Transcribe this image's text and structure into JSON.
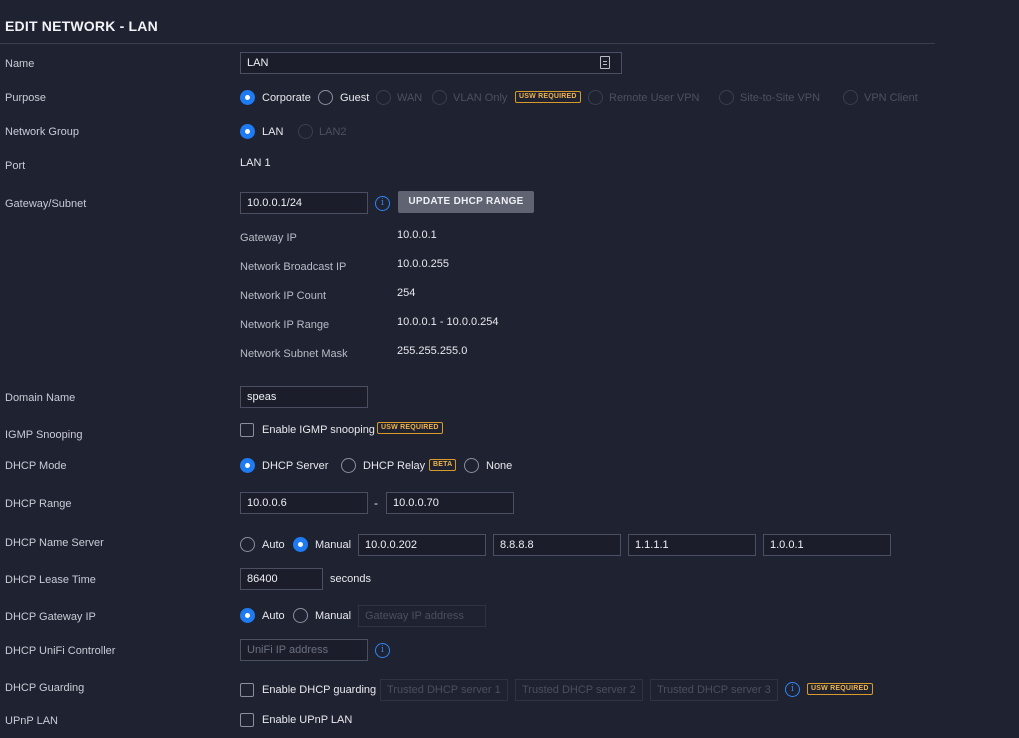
{
  "title": "EDIT NETWORK - LAN",
  "name": {
    "label": "Name",
    "value": "LAN"
  },
  "purpose": {
    "label": "Purpose",
    "options": [
      "Corporate",
      "Guest",
      "WAN",
      "VLAN Only",
      "Remote User VPN",
      "Site-to-Site VPN",
      "VPN Client"
    ],
    "selected": "Corporate",
    "badge": "USW REQUIRED"
  },
  "network_group": {
    "label": "Network Group",
    "options": [
      "LAN",
      "LAN2"
    ],
    "selected": "LAN"
  },
  "port": {
    "label": "Port",
    "value": "LAN 1"
  },
  "gateway": {
    "label": "Gateway/Subnet",
    "value": "10.0.0.1/24",
    "info_icon": "i",
    "button": "UPDATE DHCP RANGE",
    "details": [
      {
        "label": "Gateway IP",
        "value": "10.0.0.1"
      },
      {
        "label": "Network Broadcast IP",
        "value": "10.0.0.255"
      },
      {
        "label": "Network IP Count",
        "value": "254"
      },
      {
        "label": "Network IP Range",
        "value": "10.0.0.1 - 10.0.0.254"
      },
      {
        "label": "Network Subnet Mask",
        "value": "255.255.255.0"
      }
    ]
  },
  "domain": {
    "label": "Domain Name",
    "value": "speas"
  },
  "igmp": {
    "label": "IGMP Snooping",
    "checkbox_label": "Enable IGMP snooping",
    "badge": "USW REQUIRED"
  },
  "dhcp_mode": {
    "label": "DHCP Mode",
    "options": [
      "DHCP Server",
      "DHCP Relay",
      "None"
    ],
    "selected": "DHCP Server",
    "badge": "BETA"
  },
  "dhcp_range": {
    "label": "DHCP Range",
    "start": "10.0.0.6",
    "separator": "-",
    "end": "10.0.0.70"
  },
  "dns": {
    "label": "DHCP Name Server",
    "options": [
      "Auto",
      "Manual"
    ],
    "selected": "Manual",
    "servers": [
      "10.0.0.202",
      "8.8.8.8",
      "1.1.1.1",
      "1.0.0.1"
    ]
  },
  "lease": {
    "label": "DHCP Lease Time",
    "value": "86400",
    "unit": "seconds"
  },
  "dhcp_gateway": {
    "label": "DHCP Gateway IP",
    "options": [
      "Auto",
      "Manual"
    ],
    "selected": "Auto",
    "placeholder": "Gateway IP address"
  },
  "controller": {
    "label": "DHCP UniFi Controller",
    "placeholder": "UniFi IP address",
    "info_icon": "i"
  },
  "guarding": {
    "label": "DHCP Guarding",
    "checkbox_label": "Enable DHCP guarding",
    "placeholders": [
      "Trusted DHCP server 1",
      "Trusted DHCP server 2",
      "Trusted DHCP server 3"
    ],
    "info_icon": "i",
    "badge": "USW REQUIRED"
  },
  "upnp": {
    "label": "UPnP LAN",
    "checkbox_label": "Enable UPnP LAN"
  },
  "colors": {
    "background": "#1f2230",
    "accent": "#1e7bf2",
    "badge": "#f0b44c"
  }
}
